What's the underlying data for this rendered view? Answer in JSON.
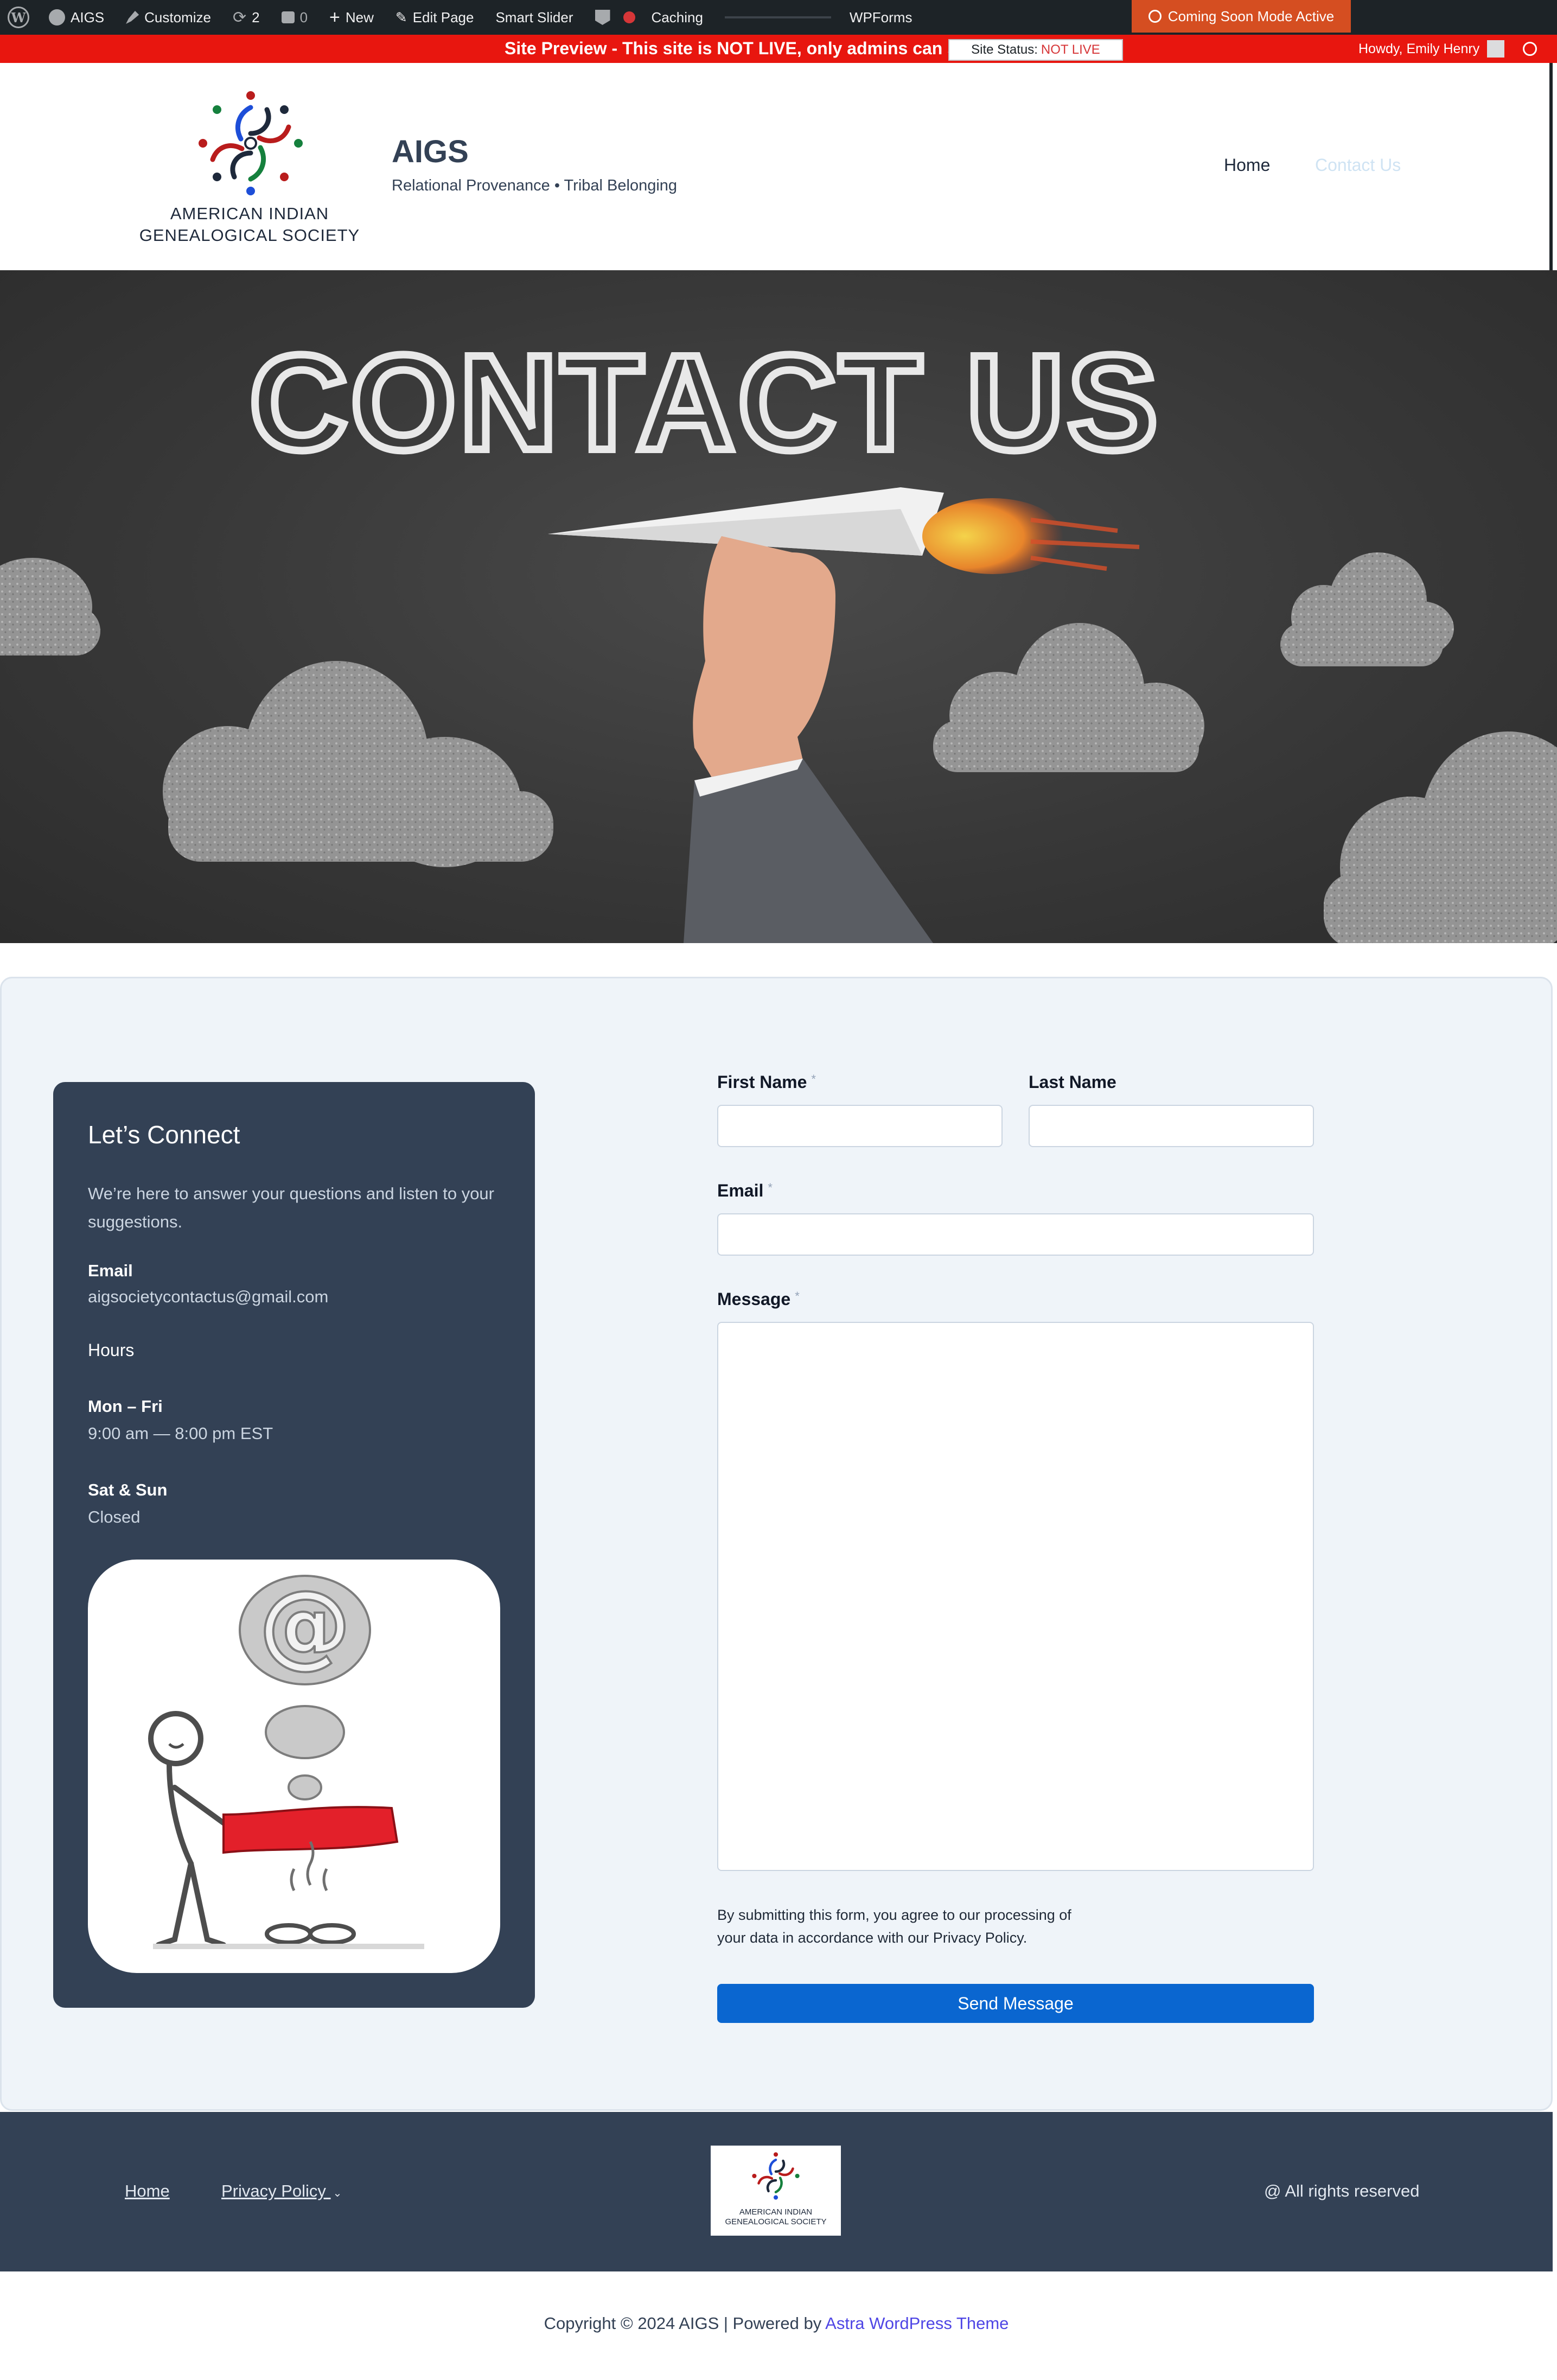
{
  "adminbar": {
    "site": "AIGS",
    "customize": "Customize",
    "updates_count": "2",
    "comments_count": "0",
    "new": "New",
    "edit_page": "Edit Page",
    "smart_slider": "Smart Slider",
    "caching": "Caching",
    "wpforms": "WPForms"
  },
  "notice": {
    "preview_text": "Site Preview - This site is NOT LIVE, only admins can s",
    "status_label": "Site Status:",
    "status_value": "NOT LIVE",
    "coming_soon": "Coming Soon Mode Active",
    "howdy": "Howdy, Emily Henry"
  },
  "header": {
    "logo_line1": "AMERICAN INDIAN",
    "logo_line2": "GENEALOGICAL SOCIETY",
    "site_title": "AIGS",
    "tagline": "Relational Provenance • Tribal Belonging",
    "nav": {
      "home": "Home",
      "contact": "Contact Us"
    }
  },
  "hero": {
    "headline": "CONTACT US"
  },
  "info": {
    "heading": "Let’s Connect",
    "intro": "We’re here to answer your questions and listen to your suggestions.",
    "email_label": "Email",
    "email": "aigsocietycontactus@gmail.com",
    "hours_label": "Hours",
    "weekday_label": "Mon – Fri",
    "weekday_hours": "9:00 am — 8:00 pm EST",
    "weekend_label": "Sat & Sun",
    "weekend_hours": "Closed"
  },
  "form": {
    "first_name": "First Name",
    "last_name": "Last Name",
    "email": "Email",
    "message": "Message",
    "required": "*",
    "privacy": "By submitting this form, you agree to our processing of your data in accordance with our Privacy Policy.",
    "send": "Send Message"
  },
  "footer": {
    "home": "Home",
    "privacy": "Privacy Policy",
    "rights": "@ All rights reserved",
    "logo_line1": "AMERICAN INDIAN",
    "logo_line2": "GENEALOGICAL SOCIETY",
    "copyright_prefix": "Copyright © 2024 AIGS | Powered by ",
    "theme_link": "Astra WordPress Theme"
  },
  "colors": {
    "admin_bar": "#1d2327",
    "notice_red": "#e8160f",
    "coming_soon_orange": "#d54e21",
    "card_navy": "#334155",
    "section_bg": "#eff4f9",
    "button_blue": "#0a66d0"
  }
}
